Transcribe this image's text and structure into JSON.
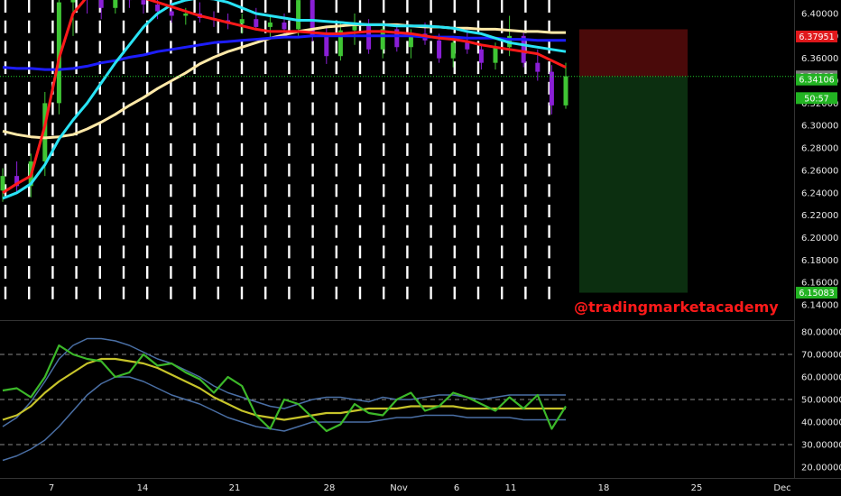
{
  "chart_data": [
    {
      "type": "candlestick",
      "title": "",
      "ylim": [
        6.13,
        6.41
      ],
      "price_ticks": [
        "6.40000",
        "6.38000",
        "6.36000",
        "6.34000",
        "6.32000",
        "6.30000",
        "6.28000",
        "6.26000",
        "6.24000",
        "6.22000",
        "6.20000",
        "6.18000",
        "6.16000",
        "6.14000"
      ],
      "tick_values": [
        6.4,
        6.38,
        6.36,
        6.34,
        6.32,
        6.3,
        6.28,
        6.26,
        6.24,
        6.22,
        6.2,
        6.18,
        6.16,
        6.14
      ],
      "x_ticks": [
        "7",
        "14",
        "21",
        "28",
        "Nov",
        "6",
        "11",
        "18",
        "25",
        "Dec"
      ],
      "price_tags": [
        {
          "label": "6.37951",
          "value": 6.37951,
          "color": "#e0181b"
        },
        {
          "label": "6.34389",
          "value": 6.34389,
          "color": "#7a7a7a"
        },
        {
          "label": "6.34106",
          "value": 6.34106,
          "color": "#22b322"
        },
        {
          "label": "50:57",
          "value": 6.3245,
          "color": "#22b322"
        },
        {
          "label": "6.15083",
          "value": 6.15083,
          "color": "#22b322"
        }
      ],
      "current_price": 6.34389,
      "position_tool": {
        "stop": 6.37951,
        "entry": 6.34389,
        "target": 6.15083
      },
      "series": [
        {
          "color": "#ffe9a8",
          "values": [
            6.295,
            6.292,
            6.29,
            6.289,
            6.29,
            6.292,
            6.297,
            6.303,
            6.31,
            6.318,
            6.325,
            6.333,
            6.34,
            6.347,
            6.355,
            6.361,
            6.366,
            6.37,
            6.374,
            6.378,
            6.381,
            6.384,
            6.386,
            6.388,
            6.389,
            6.39,
            6.39,
            6.39,
            6.39,
            6.389,
            6.388,
            6.388,
            6.387,
            6.387,
            6.386,
            6.386,
            6.385,
            6.384,
            6.384,
            6.383,
            6.383
          ]
        },
        {
          "color": "#1d1dff",
          "values": [
            6.352,
            6.351,
            6.351,
            6.35,
            6.35,
            6.351,
            6.353,
            6.356,
            6.358,
            6.361,
            6.363,
            6.366,
            6.368,
            6.37,
            6.372,
            6.374,
            6.375,
            6.376,
            6.377,
            6.378,
            6.379,
            6.379,
            6.38,
            6.38,
            6.38,
            6.38,
            6.38,
            6.38,
            6.38,
            6.38,
            6.379,
            6.379,
            6.379,
            6.378,
            6.378,
            6.378,
            6.377,
            6.377,
            6.376,
            6.376,
            6.376
          ]
        },
        {
          "color": "#29e3f5",
          "values": [
            6.235,
            6.24,
            6.248,
            6.265,
            6.288,
            6.305,
            6.32,
            6.338,
            6.356,
            6.372,
            6.388,
            6.4,
            6.408,
            6.412,
            6.414,
            6.413,
            6.41,
            6.405,
            6.4,
            6.398,
            6.396,
            6.394,
            6.394,
            6.393,
            6.392,
            6.391,
            6.39,
            6.39,
            6.389,
            6.389,
            6.389,
            6.388,
            6.387,
            6.384,
            6.382,
            6.378,
            6.374,
            6.372,
            6.37,
            6.368,
            6.366
          ]
        },
        {
          "color": "#ff1a1a",
          "values": [
            6.24,
            6.248,
            6.255,
            6.3,
            6.36,
            6.4,
            6.415,
            6.42,
            6.42,
            6.418,
            6.414,
            6.41,
            6.406,
            6.402,
            6.398,
            6.395,
            6.392,
            6.389,
            6.386,
            6.384,
            6.384,
            6.384,
            6.383,
            6.382,
            6.382,
            6.383,
            6.384,
            6.384,
            6.383,
            6.382,
            6.38,
            6.378,
            6.377,
            6.375,
            6.372,
            6.37,
            6.368,
            6.366,
            6.364,
            6.358,
            6.352
          ]
        }
      ],
      "candles": [
        [
          6.242,
          6.262,
          6.232,
          6.255
        ],
        [
          6.255,
          6.268,
          6.24,
          6.246
        ],
        [
          6.246,
          6.275,
          6.236,
          6.268
        ],
        [
          6.268,
          6.33,
          6.255,
          6.32
        ],
        [
          6.32,
          6.42,
          6.31,
          6.41
        ],
        [
          6.41,
          6.44,
          6.38,
          6.42
        ],
        [
          6.42,
          6.44,
          6.4,
          6.415
        ],
        [
          6.415,
          6.43,
          6.395,
          6.405
        ],
        [
          6.405,
          6.43,
          6.4,
          6.42
        ],
        [
          6.42,
          6.43,
          6.405,
          6.412
        ],
        [
          6.412,
          6.42,
          6.4,
          6.408
        ],
        [
          6.408,
          6.415,
          6.395,
          6.402
        ],
        [
          6.402,
          6.41,
          6.392,
          6.398
        ],
        [
          6.398,
          6.405,
          6.39,
          6.4
        ],
        [
          6.4,
          6.41,
          6.392,
          6.396
        ],
        [
          6.396,
          6.402,
          6.388,
          6.394
        ],
        [
          6.394,
          6.4,
          6.386,
          6.391
        ],
        [
          6.391,
          6.4,
          6.382,
          6.395
        ],
        [
          6.395,
          6.405,
          6.385,
          6.388
        ],
        [
          6.388,
          6.398,
          6.378,
          6.392
        ],
        [
          6.392,
          6.4,
          6.38,
          6.386
        ],
        [
          6.386,
          6.42,
          6.38,
          6.412
        ],
        [
          6.412,
          6.42,
          6.375,
          6.38
        ],
        [
          6.38,
          6.388,
          6.355,
          6.362
        ],
        [
          6.362,
          6.392,
          6.358,
          6.385
        ],
        [
          6.385,
          6.4,
          6.372,
          6.39
        ],
        [
          6.39,
          6.395,
          6.364,
          6.368
        ],
        [
          6.368,
          6.392,
          6.36,
          6.386
        ],
        [
          6.386,
          6.39,
          6.366,
          6.37
        ],
        [
          6.37,
          6.386,
          6.36,
          6.382
        ],
        [
          6.382,
          6.392,
          6.372,
          6.376
        ],
        [
          6.376,
          6.382,
          6.356,
          6.36
        ],
        [
          6.36,
          6.38,
          6.352,
          6.374
        ],
        [
          6.374,
          6.386,
          6.364,
          6.368
        ],
        [
          6.368,
          6.372,
          6.35,
          6.356
        ],
        [
          6.356,
          6.374,
          6.35,
          6.37
        ],
        [
          6.37,
          6.398,
          6.362,
          6.38
        ],
        [
          6.38,
          6.384,
          6.352,
          6.356
        ],
        [
          6.356,
          6.368,
          6.34,
          6.348
        ],
        [
          6.348,
          6.354,
          6.31,
          6.318
        ],
        [
          6.318,
          6.356,
          6.315,
          6.344
        ]
      ]
    },
    {
      "type": "line",
      "title": "",
      "ylim": [
        16,
        83
      ],
      "y_ticks": [
        "80.00000",
        "70.00000",
        "60.00000",
        "50.00000",
        "40.00000",
        "30.00000",
        "20.00000"
      ],
      "y_tick_values": [
        80,
        70,
        60,
        50,
        40,
        30,
        20
      ],
      "dashed_levels": [
        70,
        50,
        30
      ],
      "series": [
        {
          "color": "#4a6fa5",
          "values": [
            38,
            42,
            49,
            58,
            68,
            74,
            77,
            77,
            76,
            74,
            71,
            68,
            66,
            63,
            60,
            56,
            53,
            51,
            49,
            47,
            46,
            48,
            50,
            51,
            51,
            50,
            49,
            51,
            50,
            50,
            51,
            52,
            52,
            51,
            50,
            51,
            52,
            52,
            52,
            52,
            52
          ]
        },
        {
          "color": "#4a6fa5",
          "values": [
            23,
            25,
            28,
            32,
            38,
            45,
            52,
            57,
            60,
            60,
            58,
            55,
            52,
            50,
            48,
            45,
            42,
            40,
            38,
            37,
            36,
            38,
            40,
            40,
            40,
            40,
            40,
            41,
            42,
            42,
            43,
            43,
            43,
            42,
            42,
            42,
            42,
            41,
            41,
            41,
            41
          ]
        },
        {
          "color": "#c7c42a",
          "values": [
            41,
            43,
            47,
            53,
            58,
            62,
            66,
            68,
            68,
            67,
            66,
            64,
            61,
            58,
            55,
            51,
            48,
            45,
            43,
            42,
            41,
            42,
            43,
            44,
            44,
            45,
            46,
            46,
            46,
            47,
            47,
            47,
            47,
            46,
            46,
            46,
            46,
            46,
            46,
            46,
            46
          ]
        },
        {
          "color": "#3cb829",
          "values": [
            54,
            55,
            51,
            60,
            74,
            70,
            68,
            67,
            60,
            62,
            70,
            65,
            66,
            62,
            59,
            53,
            60,
            56,
            43,
            37,
            50,
            48,
            42,
            36,
            39,
            48,
            44,
            43,
            50,
            53,
            45,
            47,
            53,
            51,
            48,
            45,
            51,
            46,
            52,
            37,
            47
          ]
        }
      ]
    }
  ]
}
